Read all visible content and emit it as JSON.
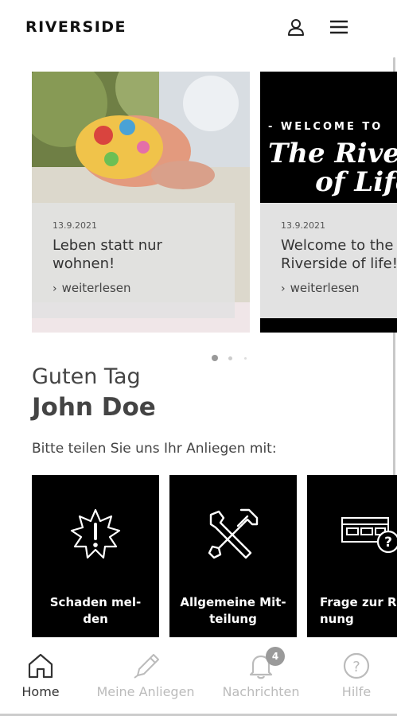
{
  "header": {
    "logo": "RIVERSIDE",
    "icons": [
      "user-icon",
      "menu-icon"
    ]
  },
  "carousel": {
    "cards": [
      {
        "date": "13.9.2021",
        "title": "Leben statt nur\nwohnen!",
        "link": "weiterlesen"
      },
      {
        "date": "13.9.2021",
        "title": "Welcome to the\nRiverside of life!",
        "link": "weiterlesen",
        "image_text": {
          "welcome": "- WELCOME TO",
          "script": "The Rivers\n     of Life"
        }
      }
    ],
    "active_index": 0,
    "count": 3
  },
  "greeting": {
    "salutation": "Guten Tag",
    "name": "John Doe",
    "prompt": "Bitte teilen Sie uns Ihr Anliegen mit:"
  },
  "tiles": [
    {
      "label": "Schaden mel-\nden",
      "icon": "damage-warning-icon"
    },
    {
      "label": "Allgemeine Mit-\nteilung",
      "icon": "tools-icon"
    },
    {
      "label": "Frage zur Re\nnung",
      "icon": "invoice-question-icon"
    }
  ],
  "bottom_nav": {
    "items": [
      {
        "label": "Home",
        "icon": "home-icon",
        "active": true
      },
      {
        "label": "Meine Anliegen",
        "icon": "pencil-icon",
        "active": false
      },
      {
        "label": "Nachrichten",
        "icon": "bell-icon",
        "active": false,
        "badge": "4"
      },
      {
        "label": "Hilfe",
        "icon": "help-icon",
        "active": false
      }
    ]
  },
  "colors": {
    "tile_background": "#000000",
    "active_nav": "#333333",
    "inactive_nav": "#bbbbbb"
  }
}
